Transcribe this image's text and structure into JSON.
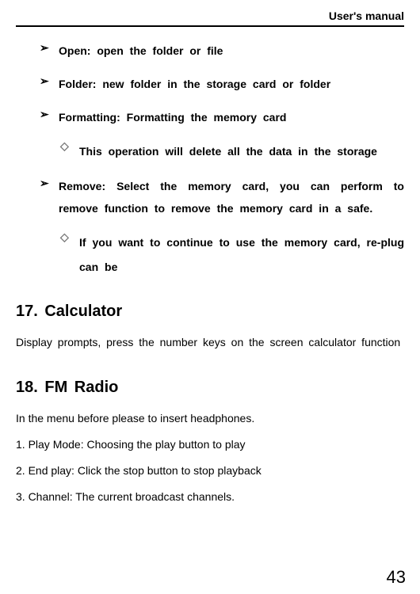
{
  "header": {
    "title": "User's manual"
  },
  "bullets": {
    "open": "Open: open the folder or file",
    "folder": "Folder: new folder in the storage card or folder",
    "formatting": "Formatting: Formatting the memory card",
    "formatting_sub": "This operation will delete all the data in the storage",
    "remove": "Remove: Select the memory card, you can perform to remove function to remove the memory card in a safe.",
    "remove_sub": "If you want to continue to use the memory card, re-plug can be"
  },
  "sections": {
    "calculator": {
      "heading": "17. Calculator",
      "body": "Display prompts, press the number keys on the screen calculator function"
    },
    "fmradio": {
      "heading": "18. FM Radio",
      "intro": "In the menu before please to insert headphones.",
      "item1": "1. Play Mode: Choosing the play button to play",
      "item2": "2. End play: Click the stop button to stop playback",
      "item3": "3. Channel: The current broadcast channels."
    }
  },
  "page": {
    "number": "43"
  }
}
